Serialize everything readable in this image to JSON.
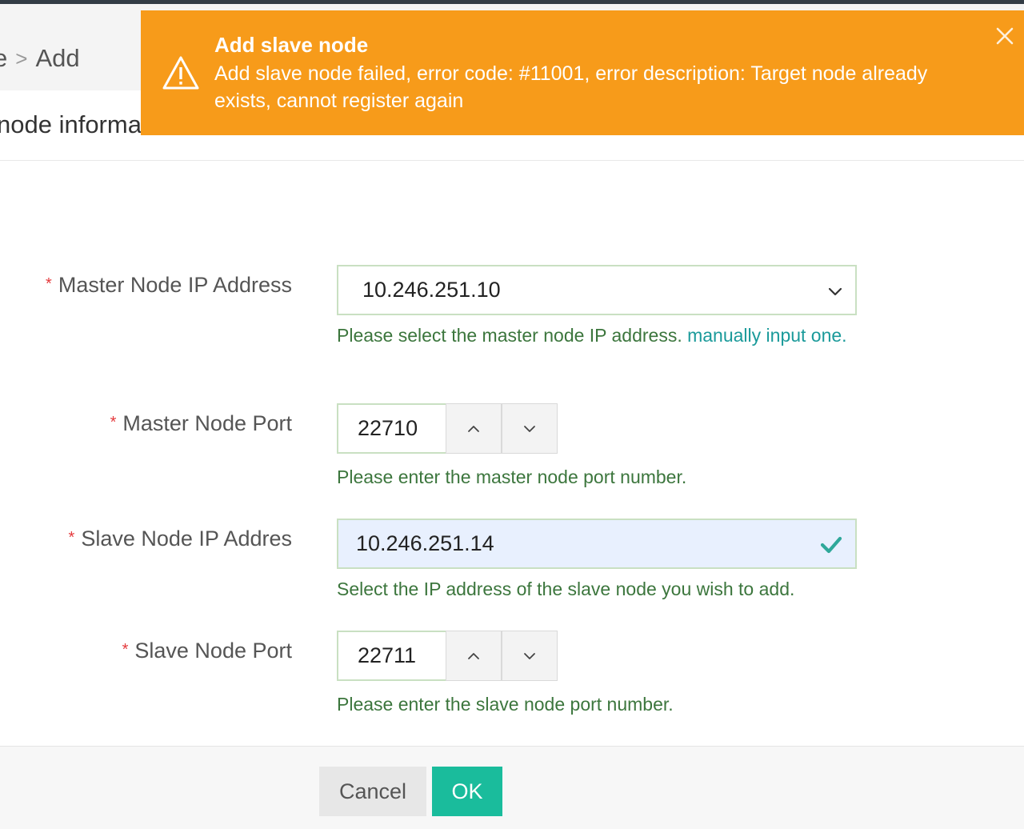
{
  "breadcrumb": {
    "prev_fragment": "e",
    "separator": ">",
    "current": "Add"
  },
  "section": {
    "title": "node information"
  },
  "notification": {
    "title": "Add slave node",
    "message": "Add slave node failed, error code: #11001, error description: Target node already exists, cannot register again",
    "icon": "warning-triangle-icon",
    "close_icon": "close-icon",
    "color": "#f79b1a"
  },
  "form": {
    "required_mark": "*",
    "master_ip": {
      "label": "Master Node IP Address",
      "value": "10.246.251.10",
      "help_text": "Please select the master node IP address.",
      "help_link": "manually input one."
    },
    "master_port": {
      "label": "Master Node Port",
      "value": "22710",
      "help_text": "Please enter the master node port number."
    },
    "slave_ip": {
      "label": "Slave Node IP Addres",
      "value": "10.246.251.14",
      "help_text": "Select the IP address of the slave node you wish to add."
    },
    "slave_port": {
      "label": "Slave Node Port",
      "value": "22711",
      "help_text": "Please enter the slave node port number."
    }
  },
  "footer": {
    "cancel_label": "Cancel",
    "ok_label": "OK",
    "ok_color": "#1abc9c"
  }
}
